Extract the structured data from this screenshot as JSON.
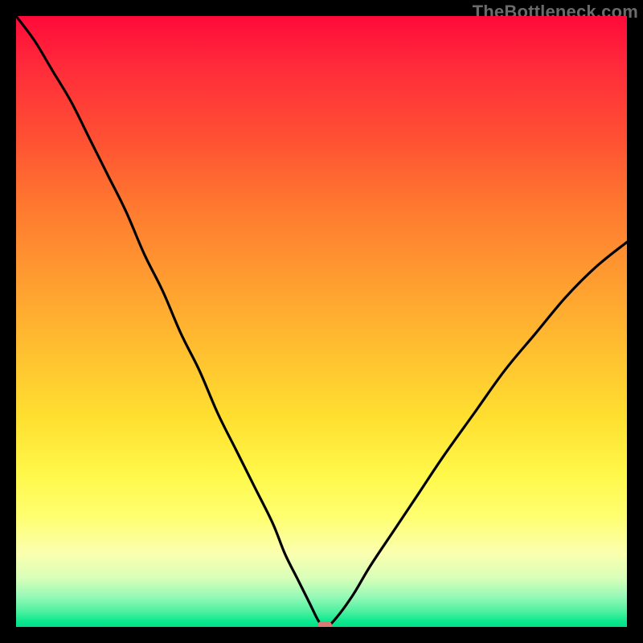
{
  "watermark": "TheBottleneck.com",
  "colors": {
    "border": "#000000",
    "curve": "#000000",
    "marker": "#d97a74",
    "gradient_top": "#ff0a3a",
    "gradient_bottom": "#00e085"
  },
  "chart_data": {
    "type": "line",
    "title": "",
    "xlabel": "",
    "ylabel": "",
    "xlim": [
      0,
      100
    ],
    "ylim": [
      0,
      100
    ],
    "grid": false,
    "series": [
      {
        "name": "bottleneck-curve",
        "x": [
          0,
          3,
          6,
          9,
          12,
          15,
          18,
          21,
          24,
          27,
          30,
          33,
          36,
          39,
          42,
          44,
          46,
          48,
          49.5,
          50.5,
          52,
          55,
          58,
          62,
          66,
          70,
          75,
          80,
          85,
          90,
          95,
          100
        ],
        "values": [
          100,
          96,
          91,
          86,
          80,
          74,
          68,
          61,
          55,
          48,
          42,
          35,
          29,
          23,
          17,
          12,
          8,
          4,
          1,
          0,
          1,
          5,
          10,
          16,
          22,
          28,
          35,
          42,
          48,
          54,
          59,
          63
        ]
      }
    ],
    "annotations": [
      {
        "name": "min-marker",
        "x": 50.5,
        "y": 0
      }
    ],
    "background_gradient": {
      "direction": "top-to-bottom",
      "stops": [
        {
          "pos": 0.0,
          "color": "#ff0a3a"
        },
        {
          "pos": 0.3,
          "color": "#ff7530"
        },
        {
          "pos": 0.55,
          "color": "#ffc030"
        },
        {
          "pos": 0.75,
          "color": "#fff84a"
        },
        {
          "pos": 0.92,
          "color": "#d8ffb8"
        },
        {
          "pos": 1.0,
          "color": "#00e085"
        }
      ]
    }
  }
}
